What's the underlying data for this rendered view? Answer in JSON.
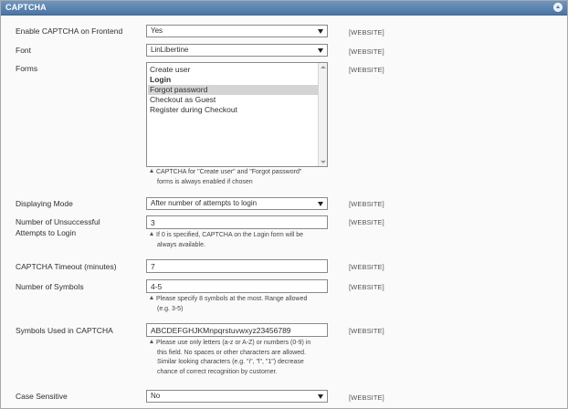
{
  "header": {
    "title": "CAPTCHA"
  },
  "scope_label": "[WEBSITE]",
  "fields": {
    "enable": {
      "label": "Enable CAPTCHA on Frontend",
      "value": "Yes"
    },
    "font": {
      "label": "Font",
      "value": "LinLibertine"
    },
    "forms": {
      "label": "Forms",
      "options": [
        {
          "label": "Create user",
          "selected": false,
          "bold": false
        },
        {
          "label": "Login",
          "selected": false,
          "bold": true
        },
        {
          "label": "Forgot password",
          "selected": true,
          "bold": false
        },
        {
          "label": "Checkout as Guest",
          "selected": false,
          "bold": false
        },
        {
          "label": "Register during Checkout",
          "selected": false,
          "bold": false
        }
      ],
      "note": [
        "CAPTCHA for \"Create user\" and \"Forgot password\"",
        "forms is always enabled if chosen"
      ]
    },
    "mode": {
      "label": "Displaying Mode",
      "value": "After number of attempts to login"
    },
    "attempts": {
      "label_line1": "Number of Unsuccessful",
      "label_line2": "Attempts to Login",
      "value": "3",
      "note": [
        "If 0 is specified, CAPTCHA on the Login form will be",
        "always available."
      ]
    },
    "timeout": {
      "label": "CAPTCHA Timeout (minutes)",
      "value": "7"
    },
    "symbols": {
      "label": "Number of Symbols",
      "value": "4-5",
      "note": [
        "Please specify 8 symbols at the most. Range allowed",
        "(e.g. 3-5)"
      ]
    },
    "symbols_used": {
      "label": "Symbols Used in CAPTCHA",
      "value": "ABCDEFGHJKMnpqrstuvwxyz23456789",
      "note": [
        "Please use only letters (a-z or A-Z) or numbers (0-9) in",
        "this field. No spaces or other characters are allowed.",
        "Similar looking characters (e.g. \"i\", \"l\", \"1\") decrease",
        "chance of correct recognition by customer."
      ]
    },
    "case": {
      "label": "Case Sensitive",
      "value": "No"
    }
  }
}
